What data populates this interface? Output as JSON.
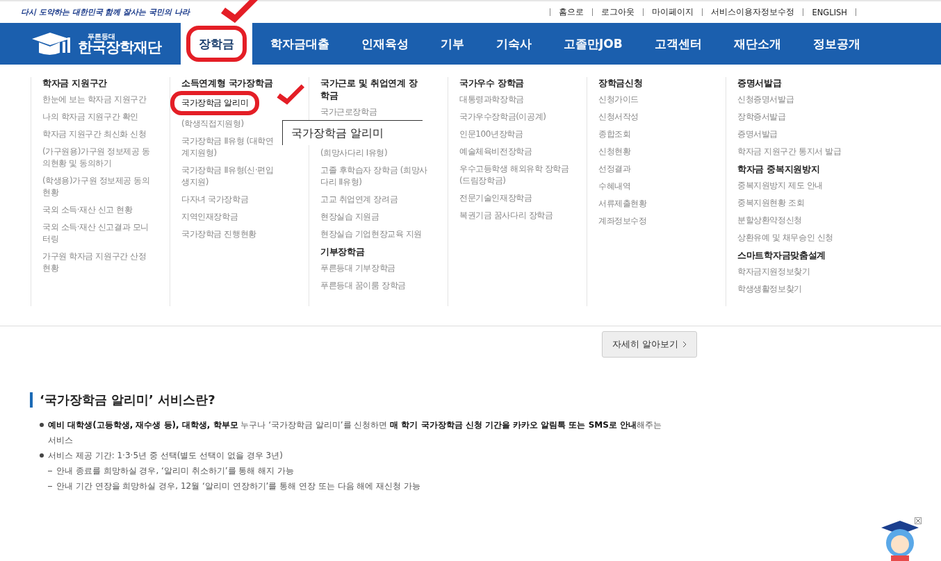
{
  "slogan": "다시 도약하는 대한민국  함께 잘사는 국민의 나라",
  "top_links": [
    "홈으로",
    "로그아웃",
    "마이페이지",
    "서비스이용자정보수정",
    "ENGLISH"
  ],
  "logo": {
    "tagline": "푸른등대",
    "name": "한국장학재단"
  },
  "nav": [
    {
      "label": "장학금",
      "selected": true
    },
    {
      "label": "학자금대출",
      "selected": false
    },
    {
      "label": "인재육성",
      "selected": false
    },
    {
      "label": "기부",
      "selected": false
    },
    {
      "label": "기숙사",
      "selected": false
    },
    {
      "label": "고졸만JOB",
      "selected": false
    },
    {
      "label": "고객센터",
      "selected": false
    },
    {
      "label": "재단소개",
      "selected": false
    },
    {
      "label": "정보공개",
      "selected": false
    }
  ],
  "menu_columns": [
    {
      "groups": [
        {
          "heading": "학자금 지원구간",
          "items": [
            {
              "label": "한눈에 보는 학자금 지원구간",
              "selected": false
            },
            {
              "label": "나의 학자금 지원구간 확인",
              "selected": false
            },
            {
              "label": "학자금 지원구간 최신화 신청",
              "selected": false
            },
            {
              "label": "(가구원용)가구원 정보제공 동의현황 및 동의하기",
              "selected": false
            },
            {
              "label": "(학생용)가구원 정보제공 동의현황",
              "selected": false
            },
            {
              "label": "국외 소득·재산 신고 현황",
              "selected": false
            },
            {
              "label": "국외 소득·재산 신고결과 모니터링",
              "selected": false
            },
            {
              "label": "가구원 학자금 지원구간 산정 현황",
              "selected": false
            }
          ]
        }
      ]
    },
    {
      "groups": [
        {
          "heading": "소득연계형 국가장학금",
          "items": [
            {
              "label": "국가장학금 알리미",
              "selected": true
            },
            {
              "label": "(학생직접지원형)",
              "selected": false
            },
            {
              "label": "국가장학금 Ⅱ유형 (대학연계지원형)",
              "selected": false
            },
            {
              "label": "국가장학금 Ⅱ유형(신·편입생지원)",
              "selected": false
            },
            {
              "label": "다자녀 국가장학금",
              "selected": false
            },
            {
              "label": "지역인재장학금",
              "selected": false
            },
            {
              "label": "국가장학금 진행현황",
              "selected": false
            }
          ]
        }
      ]
    },
    {
      "groups": [
        {
          "heading": "국가근로 및 취업연계 장학금",
          "items": [
            {
              "label": "국가근로장학금",
              "selected": false
            },
            {
              "label": "(희망사다리 Ⅰ유형)",
              "selected": false
            },
            {
              "label": "고졸 후학습자 장학금 (희망사다리 Ⅱ유형)",
              "selected": false
            },
            {
              "label": "고교 취업연계 장려금",
              "selected": false
            },
            {
              "label": "현장실습 지원금",
              "selected": false
            },
            {
              "label": "현장실습 기업현장교육 지원",
              "selected": false
            }
          ]
        },
        {
          "heading": "기부장학금",
          "items": [
            {
              "label": "푸른등대 기부장학금",
              "selected": false
            },
            {
              "label": "푸른등대 꿈이룸 장학금",
              "selected": false
            }
          ]
        }
      ]
    },
    {
      "groups": [
        {
          "heading": "국가우수 장학금",
          "items": [
            {
              "label": "대통령과학장학금",
              "selected": false
            },
            {
              "label": "국가우수장학금(이공계)",
              "selected": false
            },
            {
              "label": "인문100년장학금",
              "selected": false
            },
            {
              "label": "예술체육비전장학금",
              "selected": false
            },
            {
              "label": "우수고등학생 해외유학 장학금(드림장학금)",
              "selected": false
            },
            {
              "label": "전문기술인재장학금",
              "selected": false
            },
            {
              "label": "복권기금 꿈사다리 장학금",
              "selected": false
            }
          ]
        }
      ]
    },
    {
      "groups": [
        {
          "heading": "장학금신청",
          "items": [
            {
              "label": "신청가이드",
              "selected": false
            },
            {
              "label": "신청서작성",
              "selected": false
            },
            {
              "label": "종합조회",
              "selected": false
            },
            {
              "label": "신청현황",
              "selected": false
            },
            {
              "label": "선정결과",
              "selected": false
            },
            {
              "label": "수혜내역",
              "selected": false
            },
            {
              "label": "서류제출현황",
              "selected": false
            },
            {
              "label": "계좌정보수정",
              "selected": false
            }
          ]
        }
      ]
    },
    {
      "groups": [
        {
          "heading": "증명서발급",
          "items": [
            {
              "label": "신청증명서발급",
              "selected": false
            },
            {
              "label": "장학증서발급",
              "selected": false
            },
            {
              "label": "증명서발급",
              "selected": false
            },
            {
              "label": "학자금 지원구간 통지서 발급",
              "selected": false
            }
          ]
        },
        {
          "heading": "학자금 중복지원방지",
          "items": [
            {
              "label": "중복지원방지 제도 안내",
              "selected": false
            },
            {
              "label": "중복지원현황 조회",
              "selected": false
            },
            {
              "label": "분할상환약정신청",
              "selected": false
            },
            {
              "label": "상환유예 및 채무승인 신청",
              "selected": false
            }
          ]
        },
        {
          "heading": "스마트학자금맞춤설계",
          "items": [
            {
              "label": "학자금지원정보찾기",
              "selected": false
            },
            {
              "label": "학생생활정보찾기",
              "selected": false
            }
          ]
        }
      ]
    }
  ],
  "tooltip": "국가장학금 알리미",
  "more_button": "자세히 알아보기",
  "section_title": "‘국가장학금 알리미’ 서비스란?",
  "bullets": [
    {
      "kind": "bullet",
      "text": "**예비 대학생(고등학생, 재수생 등), 대학생, 학부모** 누구나 ‘국가장학금 알리미’를 신청하면 **매 학기 국가장학금 신청 기간을 카카오 알림톡 또는 SMS로 안내**해주는 서비스"
    },
    {
      "kind": "bullet",
      "text": "서비스 제공 기간: 1·3·5년 중 선택(별도 선택이 없을 경우 3년)"
    },
    {
      "kind": "dash",
      "text": "안내 종료를 희망하실 경우, ‘알리미 취소하기’를 통해 해지 가능"
    },
    {
      "kind": "dash",
      "text": "안내 기간 연장을 희망하실 경우, 12월 ‘알리미 연장하기’를 통해 연장 또는 다음 해에 재신청 가능"
    }
  ]
}
